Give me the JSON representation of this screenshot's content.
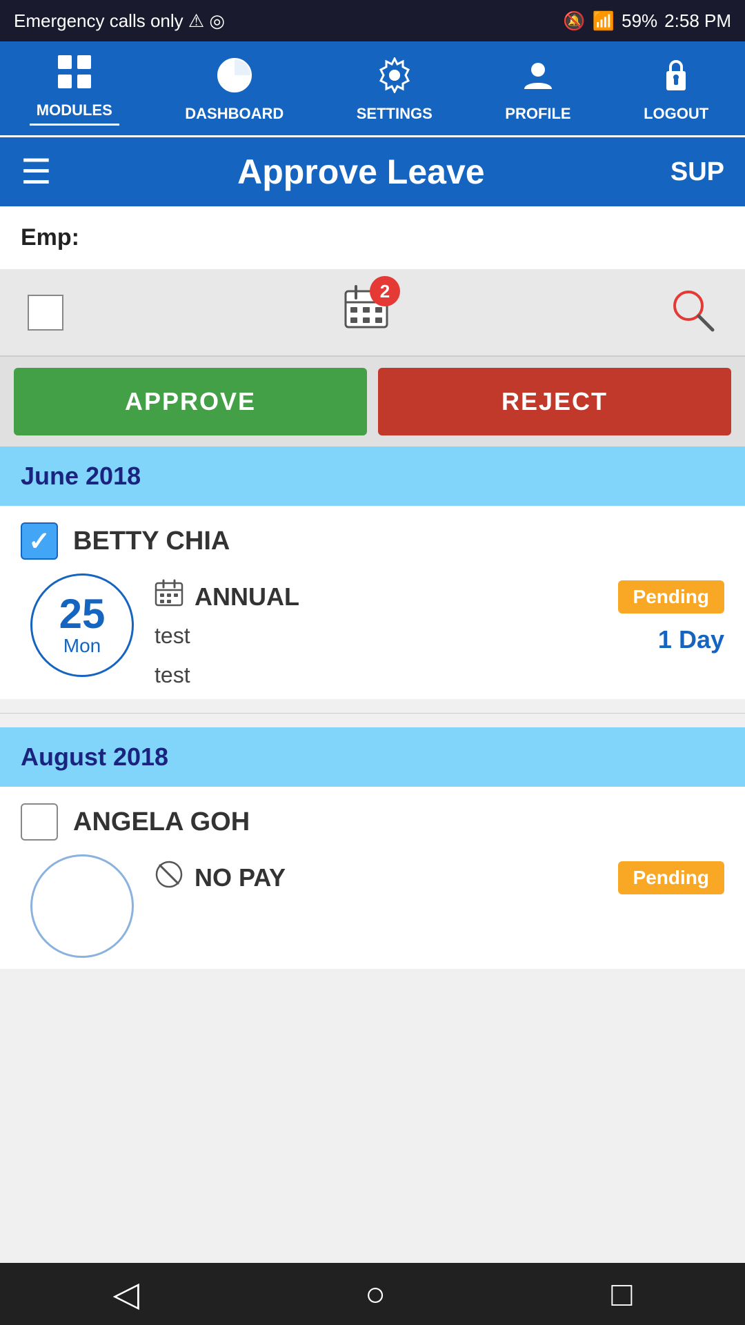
{
  "statusBar": {
    "leftText": "Emergency calls only ⚠ ◎",
    "battery": "59%",
    "time": "2:58 PM"
  },
  "topNav": {
    "items": [
      {
        "id": "modules",
        "label": "MODULES",
        "icon": "⊞",
        "active": true
      },
      {
        "id": "dashboard",
        "label": "DASHBOARD",
        "icon": "◑",
        "active": false
      },
      {
        "id": "settings",
        "label": "SETTINGS",
        "icon": "⚙",
        "active": false
      },
      {
        "id": "profile",
        "label": "PROFILE",
        "icon": "👤",
        "active": false
      },
      {
        "id": "logout",
        "label": "LOGOUT",
        "icon": "🔒",
        "active": false
      }
    ]
  },
  "header": {
    "menu_label": "☰",
    "title": "Approve Leave",
    "user": "SUP"
  },
  "empBar": {
    "label": "Emp:"
  },
  "filterBar": {
    "badgeCount": "2",
    "searchIcon": "🔍"
  },
  "actionButtons": {
    "approve": "APPROVE",
    "reject": "REJECT"
  },
  "sections": [
    {
      "monthYear": "June 2018",
      "items": [
        {
          "employeeName": "BETTY CHIA",
          "checked": true,
          "date": "25",
          "weekday": "Mon",
          "leaveType": "ANNUAL",
          "status": "Pending",
          "note1": "test",
          "note2": "test",
          "days": "1 Day"
        }
      ]
    },
    {
      "monthYear": "August 2018",
      "items": [
        {
          "employeeName": "ANGELA GOH",
          "checked": false,
          "date": "—",
          "weekday": "",
          "leaveType": "NO PAY",
          "status": "Pending",
          "note1": "",
          "note2": "",
          "days": ""
        }
      ]
    }
  ],
  "bottomNav": {
    "back": "◁",
    "home": "○",
    "recent": "□"
  }
}
